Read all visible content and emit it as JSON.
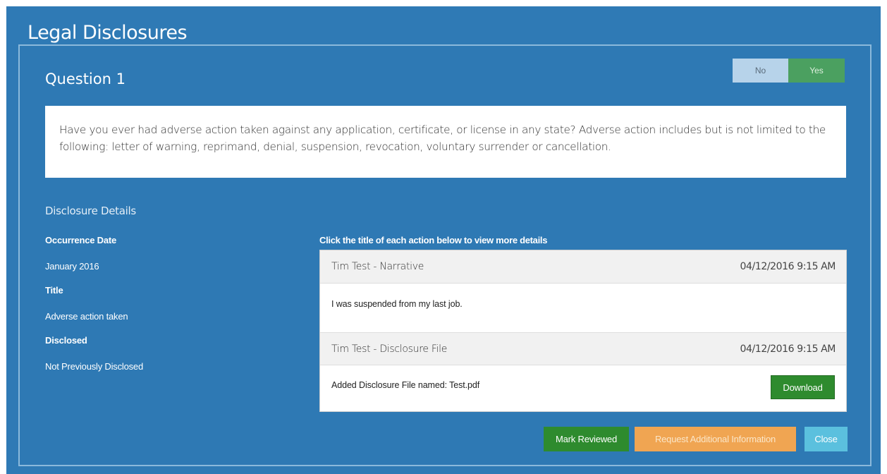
{
  "page_title": "Legal Disclosures",
  "question": {
    "title": "Question 1",
    "text": "Have you ever had adverse action taken against any application, certificate, or license in any state? Adverse action includes but is not limited to the following: letter of warning, reprimand, denial, suspension, revocation, voluntary surrender or cancellation.",
    "toggle": {
      "no_label": "No",
      "yes_label": "Yes",
      "selected": "Yes"
    }
  },
  "details": {
    "heading": "Disclosure Details",
    "occurrence_date_label": "Occurrence Date",
    "occurrence_date_value": "January 2016",
    "title_label": "Title",
    "title_value": "Adverse action taken",
    "disclosed_label": "Disclosed",
    "disclosed_value": "Not Previously Disclosed"
  },
  "actions": {
    "heading": "Click the title of each action below to view more details",
    "items": [
      {
        "title": "Tim Test - Narrative",
        "date": "04/12/2016 9:15 AM",
        "body": "I was suspended from my last job."
      },
      {
        "title": "Tim Test - Disclosure File",
        "date": "04/12/2016 9:15 AM",
        "body": "Added Disclosure File named: Test.pdf",
        "download_label": "Download"
      }
    ]
  },
  "footer": {
    "mark_reviewed_label": "Mark Reviewed",
    "request_info_label": "Request Additional Information",
    "close_label": "Close"
  },
  "colors": {
    "background": "#2f7ab5",
    "success": "#2e8b2e",
    "warning": "#f0a552",
    "info": "#5bc0de",
    "toggle_no": "#b7d3ea",
    "toggle_yes": "#4ba060"
  }
}
